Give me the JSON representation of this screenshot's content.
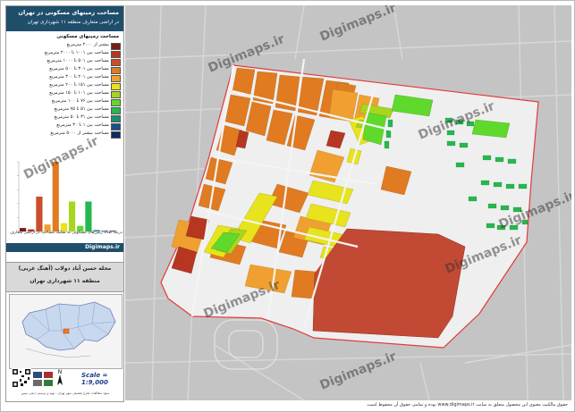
{
  "legend": {
    "title_line1": "مساحت زمینهای مسکونی در تهران",
    "title_line2": "در اراضی متعارف منطقه ۱۱ شهرداری تهران",
    "heading": "مساحت زمینهای مسکونی",
    "items": [
      {
        "label": "بیشتر از ۲۰۰۰ مترمربع",
        "color": "#7b1d16"
      },
      {
        "label": "مساحت بین ۱۰۰۱ تا ۲۰۰۰ مترمربع",
        "color": "#b73622"
      },
      {
        "label": "مساحت بین ۵۰۱ تا ۱۰۰۰ مترمربع",
        "color": "#cc4d2b"
      },
      {
        "label": "مساحت بین ۳۰۱ تا ۵۰۰ مترمربع",
        "color": "#e07b21"
      },
      {
        "label": "مساحت بین ۲۰۱ تا ۳۰۰ مترمربع",
        "color": "#f0a030"
      },
      {
        "label": "مساحت بین ۱۵۱ تا ۲۰۰ مترمربع",
        "color": "#e7e31c"
      },
      {
        "label": "مساحت بین ۱۰۱ تا ۱۵۰ مترمربع",
        "color": "#a9d51f"
      },
      {
        "label": "مساحت بین ۷۶ تا ۱۰۰ مترمربع",
        "color": "#5fd92c"
      },
      {
        "label": "مساحت بین ۵۱ تا ۷۵ مترمربع",
        "color": "#26b84e"
      },
      {
        "label": "مساحت بین ۳۱ تا ۵۰ مترمربع",
        "color": "#1b8f6a"
      },
      {
        "label": "مساحت بین ۱ تا ۳۰ مترمربع",
        "color": "#1a4f8c"
      },
      {
        "label": "مساحت بیشتر از ۵۰۰۰ مترمربع",
        "color": "#0f2a63"
      }
    ]
  },
  "chart_data": {
    "type": "bar",
    "categories": [
      "1",
      "2",
      "3",
      "4",
      "5",
      "6",
      "7",
      "8",
      "9",
      "10",
      "11",
      "12"
    ],
    "values": [
      0.5,
      0.3,
      5.0,
      1.0,
      10.0,
      1.2,
      4.3,
      0.8,
      4.3,
      0.2,
      0.1,
      0.1
    ],
    "colors": [
      "#7b1d16",
      "#b73622",
      "#cc4d2b",
      "#f0a030",
      "#e07b21",
      "#e7e31c",
      "#a9d51f",
      "#5fd92c",
      "#26b84e",
      "#1b8f6a",
      "#1a4f8c",
      "#0f2a63"
    ]
  },
  "chart_caption": "درصد تعداد زمین‌های مسکونی به تفکیک مساحت در اراضی متعارف",
  "site_banner": "Digimaps.ir",
  "place": {
    "line1": "محله حسن آباد دولاب (آهنگ غربی)",
    "line2": "منطقه ۱۱ شهرداری تهران"
  },
  "scale": "Scale = 1:9,000",
  "credit": "منبع: مطالعات طرح تفصیلی شهر تهران - تهیه و ترسیم: دیجی مپس",
  "copyright": "حقوق مالکیت معنوی این محصول متعلق به سایت www.digimaps.ir بوده و تمامی حقوق آن محفوظ است.",
  "watermarks": [
    "Digimaps.ir",
    "Digimaps.ir",
    "Digimaps.ir",
    "Digimaps.ir",
    "Digimaps.ir",
    "Digimaps.ir",
    "Digimaps.ir",
    "Digimaps.ir"
  ],
  "colors": {
    "big_parcel": "#c24a34",
    "street": "#e9e9e9",
    "background": "#bfbfbf",
    "boundary": "#e23a3a"
  }
}
